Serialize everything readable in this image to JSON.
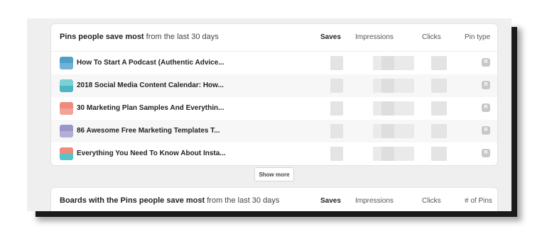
{
  "top_pins": {
    "title_bold": "Pins people save most",
    "title_rest": " from the last 30 days",
    "columns": {
      "saves": "Saves",
      "impressions": "Impressions",
      "clicks": "Clicks",
      "pin_type": "Pin type"
    },
    "rows": [
      {
        "title": "How To Start A Podcast (Authentic Advice...",
        "badge": "R",
        "thumb_colors": [
          "#4f9fc7",
          "#6fb3d6"
        ]
      },
      {
        "title": "2018 Social Media Content Calendar: How...",
        "badge": "R",
        "thumb_colors": [
          "#7ccfd4",
          "#4cb7c1"
        ]
      },
      {
        "title": "30 Marketing Plan Samples And Everythin...",
        "badge": "R",
        "thumb_colors": [
          "#ef8a7e",
          "#f3a297"
        ]
      },
      {
        "title": "86 Awesome Free Marketing Templates T...",
        "badge": "R",
        "thumb_colors": [
          "#9b96c9",
          "#b2aed6"
        ]
      },
      {
        "title": "Everything You Need To Know About Insta...",
        "badge": "R",
        "thumb_colors": [
          "#f08a7a",
          "#57c3c6"
        ]
      }
    ],
    "show_more_label": "Show more"
  },
  "top_boards": {
    "title_bold": "Boards with the Pins people save most",
    "title_rest": " from the last 30 days",
    "columns": {
      "saves": "Saves",
      "impressions": "Impressions",
      "clicks": "Clicks",
      "pins_count": "# of Pins"
    }
  }
}
